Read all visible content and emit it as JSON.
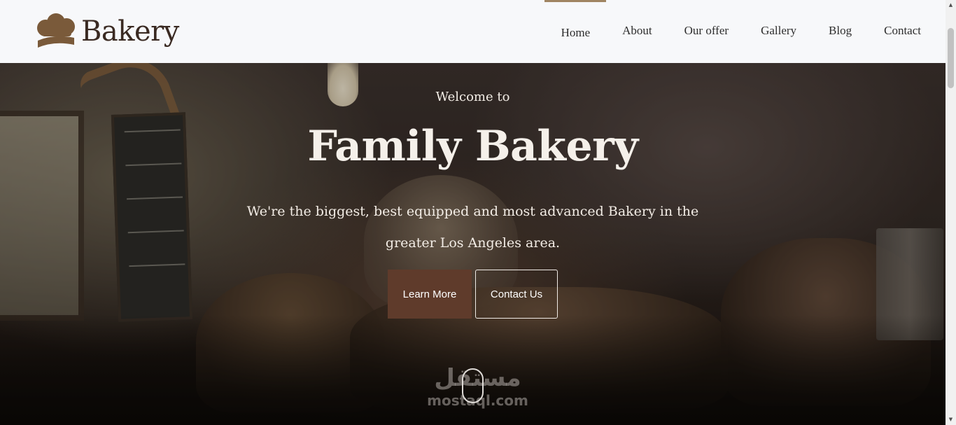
{
  "brand": {
    "name": "Bakery",
    "logo_icon": "chef-hat-icon",
    "logo_color": "#7a5a3a"
  },
  "nav": {
    "items": [
      {
        "label": "Home",
        "active": true
      },
      {
        "label": "About",
        "active": false
      },
      {
        "label": "Our offer",
        "active": false
      },
      {
        "label": "Gallery",
        "active": false
      },
      {
        "label": "Blog",
        "active": false
      },
      {
        "label": "Contact",
        "active": false
      }
    ],
    "active_indicator_color": "#a08562"
  },
  "hero": {
    "welcome": "Welcome to",
    "title": "Family Bakery",
    "subtitle": "We're the biggest, best equipped and most advanced Bakery in the greater Los Angeles area.",
    "primary_button": "Learn More",
    "secondary_button": "Contact Us",
    "primary_button_color": "#5f3b2b",
    "scroll_icon": "mouse-scroll-icon"
  },
  "watermark": {
    "arabic": "مستقل",
    "latin": "mostaql.com"
  },
  "colors": {
    "header_bg": "#f7f8fa",
    "text_dark": "#2d2d2d",
    "text_light": "#f5f0ea"
  }
}
